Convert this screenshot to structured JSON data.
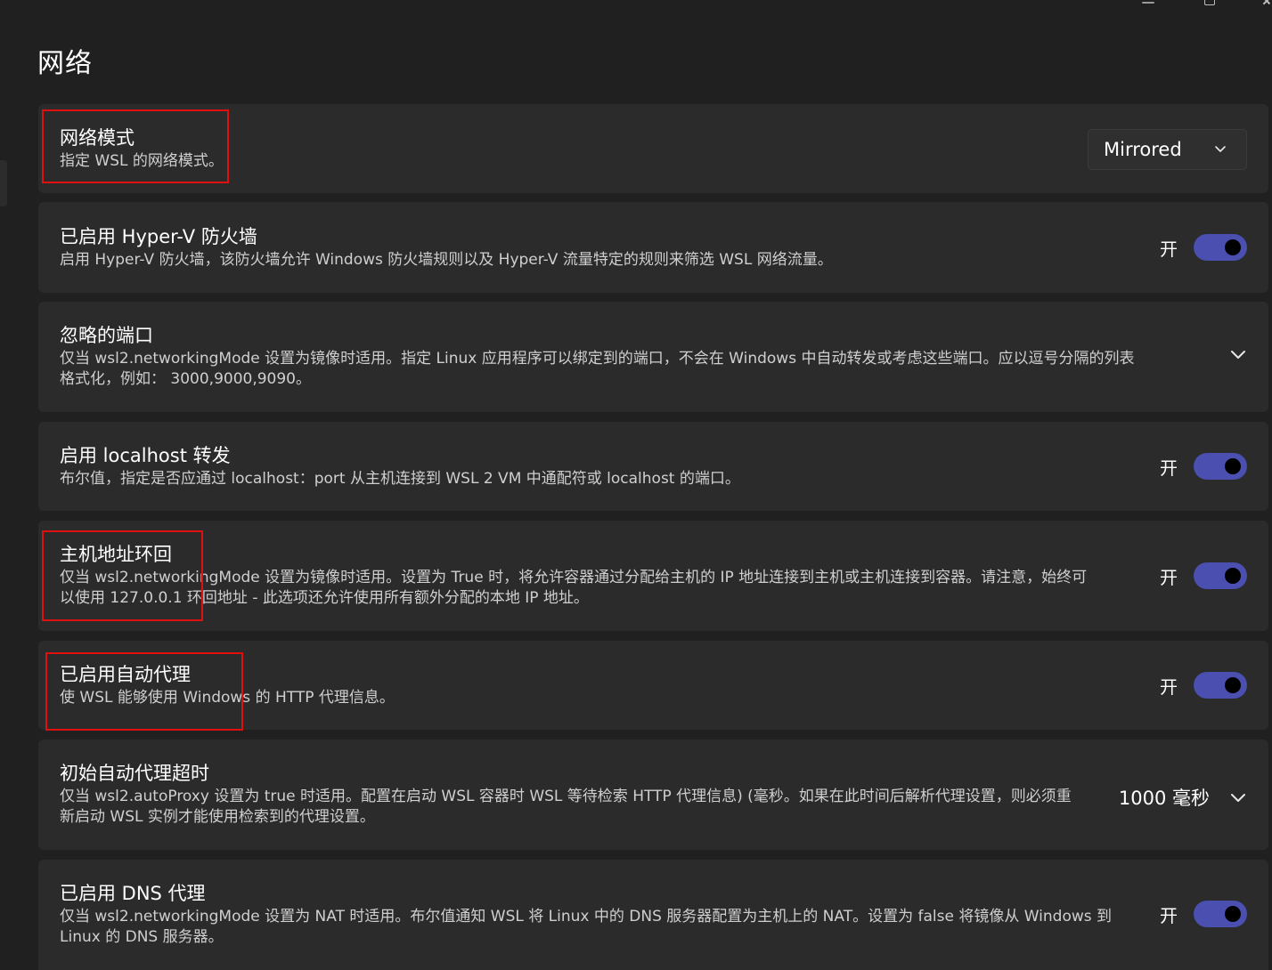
{
  "page": {
    "title": "网络"
  },
  "settings": [
    {
      "title": "网络模式",
      "description": "指定 WSL 的网络模式。",
      "control": "dropdown",
      "value": "Mirrored"
    },
    {
      "title": "已启用 Hyper-V 防火墙",
      "description": "启用 Hyper-V 防火墙，该防火墙允许 Windows 防火墙规则以及 Hyper-V 流量特定的规则来筛选 WSL 网络流量。",
      "control": "toggle",
      "state_label": "开",
      "on": true
    },
    {
      "title": "忽略的端口",
      "description_line1": "仅当 wsl2.networkingMode 设置为镜像时适用。指定 Linux 应用程序可以绑定到的端口，不会在 Windows 中自动转发或考虑这些端口。应以逗号分隔的列表",
      "description_line2": "格式化，例如： 3000,9000,9090。",
      "control": "expander"
    },
    {
      "title": "启用 localhost 转发",
      "description": "布尔值，指定是否应通过 localhost：port 从主机连接到 WSL 2 VM 中通配符或 localhost 的端口。",
      "control": "toggle",
      "state_label": "开",
      "on": true
    },
    {
      "title": "主机地址环回",
      "description_line1": "仅当 wsl2.networkingMode 设置为镜像时适用。设置为 True 时，将允许容器通过分配给主机的 IP 地址连接到主机或主机连接到容器。请注意，始终可",
      "description_line2": "以使用 127.0.0.1 环回地址 - 此选项还允许使用所有额外分配的本地 IP 地址。",
      "control": "toggle",
      "state_label": "开",
      "on": true
    },
    {
      "title": "已启用自动代理",
      "description": "使 WSL 能够使用 Windows 的 HTTP 代理信息。",
      "control": "toggle",
      "state_label": "开",
      "on": true
    },
    {
      "title": "初始自动代理超时",
      "description_line1": "仅当 wsl2.autoProxy 设置为 true 时适用。配置在启动 WSL 容器时 WSL 等待检索 HTTP 代理信息) (毫秒。如果在此时间后解析代理设置，则必须重",
      "description_line2": "新启动 WSL 实例才能使用检索到的代理设置。",
      "control": "expander",
      "value": "1000 毫秒"
    },
    {
      "title": "已启用 DNS 代理",
      "description_line1": "仅当 wsl2.networkingMode 设置为 NAT 时适用。布尔值通知 WSL 将 Linux 中的 DNS 服务器配置为主机上的 NAT。设置为 false 将镜像从 Windows 到",
      "description_line2": "Linux 的 DNS 服务器。",
      "control": "toggle",
      "state_label": "开",
      "on": true
    }
  ],
  "colors": {
    "background": "#202020",
    "card": "#2b2b2b",
    "toggle_on": "#4a4fb0",
    "highlight": "#e01010"
  }
}
